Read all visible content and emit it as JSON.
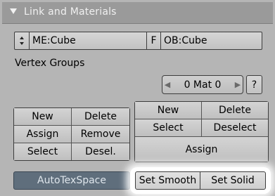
{
  "panel": {
    "title": "Link and Materials",
    "collapse_icon": "triangle-down-icon"
  },
  "mesh_row": {
    "mesh_name": "ME:Cube",
    "fake_user": "F",
    "object_name": "OB:Cube",
    "browse_icon": "up-down-arrows-icon"
  },
  "vertex_groups": {
    "label": "Vertex Groups"
  },
  "material": {
    "counter": "0 Mat 0",
    "prev_icon": "chevron-left-icon",
    "next_icon": "chevron-right-icon",
    "help": "?"
  },
  "vgroup_buttons": {
    "new": "New",
    "delete": "Delete",
    "assign": "Assign",
    "remove": "Remove",
    "select": "Select",
    "deselect": "Desel."
  },
  "mat_buttons": {
    "new": "New",
    "delete": "Delete",
    "select": "Select",
    "deselect": "Deselect",
    "assign": "Assign"
  },
  "bottom": {
    "autotexspace": "AutoTexSpace",
    "set_smooth": "Set Smooth",
    "set_solid": "Set Solid"
  },
  "colors": {
    "panel_bg": "#b5b5b5",
    "header_bg": "#9a9a9a",
    "autotex_bg": "#5f6e7c",
    "highlight": "#ffffff"
  }
}
